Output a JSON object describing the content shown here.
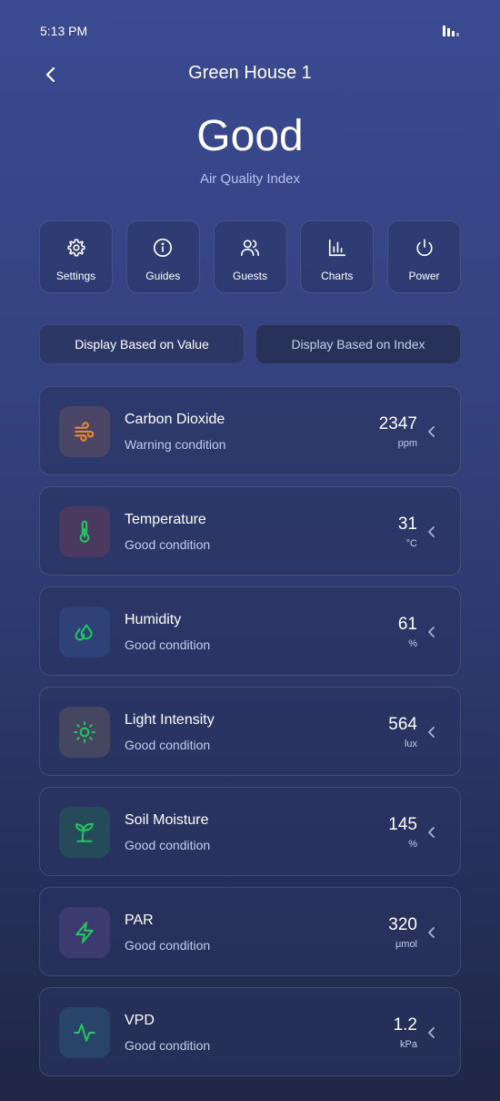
{
  "status_bar": {
    "time": "5:13 PM",
    "signal_icon": "signal-bars-icon"
  },
  "header": {
    "back_icon": "chevron-left-icon",
    "title": "Green House 1"
  },
  "aqi": {
    "status": "Good",
    "label": "Air Quality Index"
  },
  "actions": [
    {
      "label": "Settings",
      "icon": "gear-icon"
    },
    {
      "label": "Guides",
      "icon": "info-icon"
    },
    {
      "label": "Guests",
      "icon": "users-icon"
    },
    {
      "label": "Charts",
      "icon": "bar-chart-icon"
    },
    {
      "label": "Power",
      "icon": "power-icon"
    }
  ],
  "display_toggle": {
    "value_label": "Display Based on Value",
    "index_label": "Display Based on Index",
    "selected": "value"
  },
  "sensors": [
    {
      "name": "Carbon Dioxide",
      "condition": "Warning condition",
      "value": "2347",
      "unit": "ppm",
      "icon": "wind-icon",
      "color": "#f0892e",
      "bg": "#4b4566"
    },
    {
      "name": "Temperature",
      "condition": "Good condition",
      "value": "31",
      "unit": "°C",
      "icon": "thermometer-icon",
      "color": "#22c55e",
      "bg": "#4a3a60"
    },
    {
      "name": "Humidity",
      "condition": "Good condition",
      "value": "61",
      "unit": "%",
      "icon": "droplets-icon",
      "color": "#22c55e",
      "bg": "#2f4278"
    },
    {
      "name": "Light Intensity",
      "condition": "Good condition",
      "value": "564",
      "unit": "lux",
      "icon": "sun-icon",
      "color": "#22c55e",
      "bg": "#454660"
    },
    {
      "name": "Soil Moisture",
      "condition": "Good condition",
      "value": "145",
      "unit": "%",
      "icon": "sprout-icon",
      "color": "#22c55e",
      "bg": "#254a5a"
    },
    {
      "name": "PAR",
      "condition": "Good condition",
      "value": "320",
      "unit": "μmol",
      "icon": "lightning-icon",
      "color": "#22c55e",
      "bg": "#3b3b70"
    },
    {
      "name": "VPD",
      "condition": "Good condition",
      "value": "1.2",
      "unit": "kPa",
      "icon": "activity-icon",
      "color": "#22c55e",
      "bg": "#284468"
    }
  ],
  "colors": {
    "accent_warning": "#f0892e",
    "accent_good": "#22c55e",
    "background_top": "#3b4a92",
    "background_bottom": "#1f2646"
  }
}
